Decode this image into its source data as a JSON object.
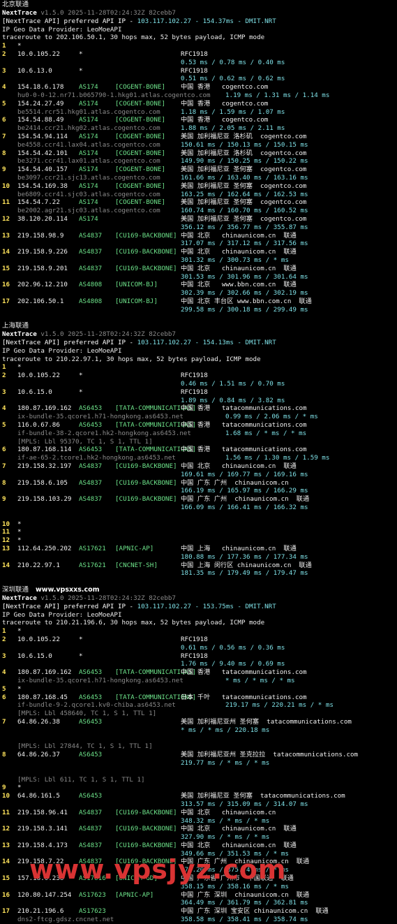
{
  "sections": [
    {
      "title": "北京联通",
      "nt_name": "NextTrace",
      "nt_ver": "v1.5.0 2025-11-28T02:24:32Z 82cebb7",
      "api_line_a": "[NextTrace API] preferred API IP - ",
      "api_ip": "103.117.102.27 - 154.37ms - DMIT.NRT",
      "geo_provider": "IP Geo Data Provider: LeoMoeAPI",
      "trace_line": "traceroute to 202.106.50.1, 30 hops max, 52 bytes payload, ICMP mode",
      "rows": [
        {
          "k": "hop",
          "num": "1",
          "star": "*"
        },
        {
          "k": "hop",
          "num": "2",
          "ip": "10.0.105.22",
          "asn": "*",
          "geo": "RFC1918"
        },
        {
          "k": "lat",
          "lat": "0.53 ms / 0.78 ms / 0.40 ms"
        },
        {
          "k": "hop",
          "num": "3",
          "ip": "10.6.13.0",
          "asn": "*",
          "geo": "RFC1918"
        },
        {
          "k": "lat",
          "lat": "0.51 ms / 0.62 ms / 0.62 ms"
        },
        {
          "k": "hop",
          "num": "4",
          "ip": "154.18.6.178",
          "asn": "AS174",
          "tag": "[COGENT-BONE]",
          "geo": "中国 香港   cogentco.com"
        },
        {
          "k": "hostlat",
          "host": "hu0-0-0-12.nr71.b065790-1.hkg01.atlas.cogentco.com",
          "lat": "1.19 ms / 1.31 ms / 1.14 ms"
        },
        {
          "k": "hop",
          "num": "5",
          "ip": "154.24.27.49",
          "asn": "AS174",
          "tag": "[COGENT-BONE]",
          "geo": "中国 香港   cogentco.com"
        },
        {
          "k": "hostlat2",
          "host": "be5514.rcr51.hkg01.atlas.cogentco.com",
          "lat": "1.18 ms / 1.59 ms / 1.07 ms"
        },
        {
          "k": "hop",
          "num": "6",
          "ip": "154.54.88.49",
          "asn": "AS174",
          "tag": "[COGENT-BONE]",
          "geo": "中国 香港   cogentco.com"
        },
        {
          "k": "hostlat2",
          "host": "be2414.ccr21.hkg02.atlas.cogentco.com",
          "lat": "1.88 ms / 2.05 ms / 2.11 ms"
        },
        {
          "k": "hop",
          "num": "7",
          "ip": "154.54.94.114",
          "asn": "AS174",
          "tag": "[COGENT-BONE]",
          "geo": "美国 加利福尼亚 洛杉矶  cogentco.com"
        },
        {
          "k": "hostlat2",
          "host": "be4558.ccr41.lax04.atlas.cogentco.com",
          "lat": "150.61 ms / 150.13 ms / 150.15 ms"
        },
        {
          "k": "hop",
          "num": "8",
          "ip": "154.54.42.101",
          "asn": "AS174",
          "tag": "[COGENT-BONE]",
          "geo": "美国 加利福尼亚 洛杉矶  cogentco.com"
        },
        {
          "k": "hostlat2",
          "host": "be3271.ccr41.lax01.atlas.cogentco.com",
          "lat": "149.90 ms / 150.25 ms / 150.22 ms"
        },
        {
          "k": "hop",
          "num": "9",
          "ip": "154.54.40.157",
          "asn": "AS174",
          "tag": "[COGENT-BONE]",
          "geo": "美国 加利福尼亚 圣何塞  cogentco.com"
        },
        {
          "k": "hostlat2",
          "host": "be3097.ccr21.sjc13.atlas.cogentco.com",
          "lat": "161.66 ms / 163.40 ms / 163.16 ms"
        },
        {
          "k": "hop",
          "num": "10",
          "ip": "154.54.169.38",
          "asn": "AS174",
          "tag": "[COGENT-BONE]",
          "geo": "美国 加利福尼亚 圣何塞  cogentco.com"
        },
        {
          "k": "hostlat2",
          "host": "be6809.ccr41.sjc03.atlas.cogentco.com",
          "lat": "163.25 ms / 162.64 ms / 162.53 ms"
        },
        {
          "k": "hop",
          "num": "11",
          "ip": "154.54.7.22",
          "asn": "AS174",
          "tag": "[COGENT-BONE]",
          "geo": "美国 加利福尼亚 圣何塞  cogentco.com"
        },
        {
          "k": "hostlat2",
          "host": "be2002.agr21.sjc03.atlas.cogentco.com",
          "lat": "160.74 ms / 160.70 ms / 160.52 ms"
        },
        {
          "k": "hop",
          "num": "12",
          "ip": "38.120.20.114",
          "asn": "AS174",
          "geo": "美国 加利福尼亚 圣何塞  cogentco.com"
        },
        {
          "k": "lat",
          "lat": "356.12 ms / 356.77 ms / 355.87 ms"
        },
        {
          "k": "hop",
          "num": "13",
          "ip": "219.158.98.9",
          "asn": "AS4837",
          "tag": "[CU169-BACKBONE]",
          "geo": "中国 北京   chinaunicom.cn  联通"
        },
        {
          "k": "lat",
          "lat": "317.07 ms / 317.12 ms / 317.56 ms"
        },
        {
          "k": "hop",
          "num": "14",
          "ip": "219.158.9.226",
          "asn": "AS4837",
          "tag": "[CU169-BACKBONE]",
          "geo": "中国 北京   chinaunicom.cn  联通"
        },
        {
          "k": "lat",
          "lat": "301.32 ms / 300.73 ms / * ms"
        },
        {
          "k": "hop",
          "num": "15",
          "ip": "219.158.9.201",
          "asn": "AS4837",
          "tag": "[CU169-BACKBONE]",
          "geo": "中国 北京   chinaunicom.cn  联通"
        },
        {
          "k": "lat",
          "lat": "301.53 ms / 301.96 ms / 301.64 ms"
        },
        {
          "k": "hop",
          "num": "16",
          "ip": "202.96.12.210",
          "asn": "AS4808",
          "tag": "[UNICOM-BJ]",
          "geo": "中国 北京   www.bbn.com.cn  联通"
        },
        {
          "k": "lat",
          "lat": "302.39 ms / 302.66 ms / 302.19 ms"
        },
        {
          "k": "hop",
          "num": "17",
          "ip": "202.106.50.1",
          "asn": "AS4808",
          "tag": "[UNICOM-BJ]",
          "geo": "中国 北京 丰台区 www.bbn.com.cn  联通"
        },
        {
          "k": "lat",
          "lat": "299.58 ms / 300.18 ms / 299.49 ms"
        },
        {
          "k": "gap"
        }
      ]
    },
    {
      "title": "上海联通",
      "nt_name": "NextTrace",
      "nt_ver": "v1.5.0 2025-11-28T02:24:32Z 82cebb7",
      "api_line_a": "[NextTrace API] preferred API IP - ",
      "api_ip": "103.117.102.27 - 154.13ms - DMIT.NRT",
      "geo_provider": "IP Geo Data Provider: LeoMoeAPI",
      "trace_line": "traceroute to 210.22.97.1, 30 hops max, 52 bytes payload, ICMP mode",
      "rows": [
        {
          "k": "hop",
          "num": "1",
          "star": "*"
        },
        {
          "k": "hop",
          "num": "2",
          "ip": "10.0.105.22",
          "asn": "*",
          "geo": "RFC1918"
        },
        {
          "k": "lat",
          "lat": "0.46 ms / 1.51 ms / 0.70 ms"
        },
        {
          "k": "hop",
          "num": "3",
          "ip": "10.6.15.0",
          "asn": "*",
          "geo": "RFC1918"
        },
        {
          "k": "lat",
          "lat": "1.89 ms / 0.84 ms / 3.82 ms"
        },
        {
          "k": "hop",
          "num": "4",
          "ip": "180.87.169.162",
          "asn": "AS6453",
          "tag": "[TATA-COMMUNICATIONS]",
          "geo": "中国 香港   tatacommunications.com"
        },
        {
          "k": "hostlat",
          "host": "ix-bundle-35.qcore1.h71-hongkong.as6453.net",
          "lat": "0.99 ms / 2.06 ms / * ms"
        },
        {
          "k": "hop",
          "num": "5",
          "ip": "116.0.67.86",
          "asn": "AS6453",
          "tag": "[TATA-COMMUNICATIONS]",
          "geo": "中国 香港   tatacommunications.com"
        },
        {
          "k": "hostlat",
          "host": "if-bundle-38-2.qcore1.hk2-hongkong.as6453.net",
          "lat": "1.68 ms / * ms / * ms"
        },
        {
          "k": "mpls",
          "text": "[MPLS: Lbl 95370, TC 1, S 1, TTL 1]"
        },
        {
          "k": "hop",
          "num": "6",
          "ip": "180.87.168.114",
          "asn": "AS6453",
          "tag": "[TATA-COMMUNICATIONS]",
          "geo": "中国 香港   tatacommunications.com"
        },
        {
          "k": "hostlat",
          "host": "if-ae-65-2.tcore1.hk2-hongkong.as6453.net",
          "lat": "1.56 ms / 1.30 ms / 1.59 ms"
        },
        {
          "k": "hop",
          "num": "7",
          "ip": "219.158.32.197",
          "asn": "AS4837",
          "tag": "[CU169-BACKBONE]",
          "geo": "中国 北京   chinaunicom.cn  联通"
        },
        {
          "k": "lat",
          "lat": "169.61 ms / 169.77 ms / 169.16 ms"
        },
        {
          "k": "hop",
          "num": "8",
          "ip": "219.158.6.105",
          "asn": "AS4837",
          "tag": "[CU169-BACKBONE]",
          "geo": "中国 广东 广州  chinaunicom.cn"
        },
        {
          "k": "lat",
          "lat": "166.19 ms / 165.97 ms / 166.29 ms"
        },
        {
          "k": "hop",
          "num": "9",
          "ip": "219.158.103.29",
          "asn": "AS4837",
          "tag": "[CU169-BACKBONE]",
          "geo": "中国 广东 广州  chinaunicom.cn  联通"
        },
        {
          "k": "lat",
          "lat": "166.09 ms / 166.41 ms / 166.32 ms"
        },
        {
          "k": "gap"
        },
        {
          "k": "hop",
          "num": "10",
          "star": "*"
        },
        {
          "k": "hop",
          "num": "11",
          "star": "*"
        },
        {
          "k": "hop",
          "num": "12",
          "star": "*"
        },
        {
          "k": "hop",
          "num": "13",
          "ip": "112.64.250.202",
          "asn": "AS17621",
          "tag": "[APNIC-AP]",
          "geo": "中国 上海   chinaunicom.cn  联通"
        },
        {
          "k": "lat",
          "lat": "180.88 ms / 177.36 ms / 177.34 ms"
        },
        {
          "k": "hop",
          "num": "14",
          "ip": "210.22.97.1",
          "asn": "AS17621",
          "tag": "[CNCNET-SH]",
          "geo": "中国 上海 闵行区 chinaunicom.cn  联通"
        },
        {
          "k": "lat",
          "lat": "181.35 ms / 179.49 ms / 179.47 ms"
        },
        {
          "k": "gap"
        }
      ]
    },
    {
      "title": "深圳联通",
      "url": "www.vpsxxs.com",
      "nt_name": "NextTrace",
      "nt_ver": "v1.5.0 2025-11-28T02:24:32Z 82cebb7",
      "api_line_a": "[NextTrace API] preferred API IP - ",
      "api_ip": "103.117.102.27 - 153.75ms - DMIT.NRT",
      "geo_provider": "IP Geo Data Provider: LeoMoeAPI",
      "trace_line": "traceroute to 210.21.196.6, 30 hops max, 52 bytes payload, ICMP mode",
      "rows": [
        {
          "k": "hop",
          "num": "1",
          "star": "*"
        },
        {
          "k": "hop",
          "num": "2",
          "ip": "10.0.105.22",
          "asn": "*",
          "geo": "RFC1918"
        },
        {
          "k": "lat",
          "lat": "0.61 ms / 0.56 ms / 0.36 ms"
        },
        {
          "k": "hop",
          "num": "3",
          "ip": "10.6.15.0",
          "asn": "*",
          "geo": "RFC1918"
        },
        {
          "k": "lat",
          "lat": "1.76 ms / 9.40 ms / 0.69 ms"
        },
        {
          "k": "hop",
          "num": "4",
          "ip": "180.87.169.162",
          "asn": "AS6453",
          "tag": "[TATA-COMMUNICATIONS]",
          "geo": "中国 香港   tatacommunications.com"
        },
        {
          "k": "hostlat",
          "host": "ix-bundle-35.qcore1.h71-hongkong.as6453.net",
          "lat": "* ms / * ms / * ms"
        },
        {
          "k": "hop",
          "num": "5",
          "star": "*"
        },
        {
          "k": "hop",
          "num": "6",
          "ip": "180.87.168.45",
          "asn": "AS6453",
          "tag": "[TATA-COMMUNICATIONS]",
          "geo": "日本 千叶   tatacommunications.com"
        },
        {
          "k": "hostlat",
          "host": "if-bundle-9-2.qcore1.kv0-chiba.as6453.net",
          "lat": "219.17 ms / 220.21 ms / * ms"
        },
        {
          "k": "mpls",
          "text": "[MPLS: Lbl 458640, TC 1, S 1, TTL 1]"
        },
        {
          "k": "hop",
          "num": "7",
          "ip": "64.86.26.38",
          "asn": "AS6453",
          "geo": "美国 加利福尼亚州 圣何塞  tatacommunications.com"
        },
        {
          "k": "lat",
          "lat": "* ms / * ms / 220.18 ms"
        },
        {
          "k": "gap"
        },
        {
          "k": "mpls",
          "text": "[MPLS: Lbl 27844, TC 1, S 1, TTL 1]"
        },
        {
          "k": "hop",
          "num": "8",
          "ip": "64.86.26.37",
          "asn": "AS6453",
          "geo": "美国 加利福尼亚州 圣克拉拉  tatacommunications.com"
        },
        {
          "k": "lat",
          "lat": "219.77 ms / * ms / * ms"
        },
        {
          "k": "gap"
        },
        {
          "k": "mpls",
          "text": "[MPLS: Lbl 611, TC 1, S 1, TTL 1]"
        },
        {
          "k": "hop",
          "num": "9",
          "star": "*"
        },
        {
          "k": "hop",
          "num": "10",
          "ip": "64.86.161.5",
          "asn": "AS6453",
          "geo": "美国 加利福尼亚 圣何塞  tatacommunications.com"
        },
        {
          "k": "lat",
          "lat": "313.57 ms / 315.09 ms / 314.07 ms"
        },
        {
          "k": "hop",
          "num": "11",
          "ip": "219.158.96.41",
          "asn": "AS4837",
          "tag": "[CU169-BACKBONE]",
          "geo": "中国 北京   chinaunicom.cn"
        },
        {
          "k": "lat",
          "lat": "348.32 ms / * ms / * ms"
        },
        {
          "k": "hop",
          "num": "12",
          "ip": "219.158.3.141",
          "asn": "AS4837",
          "tag": "[CU169-BACKBONE]",
          "geo": "中国 北京   chinaunicom.cn  联通"
        },
        {
          "k": "lat",
          "lat": "327.90 ms / * ms / * ms"
        },
        {
          "k": "hop",
          "num": "13",
          "ip": "219.158.4.173",
          "asn": "AS4837",
          "tag": "[CU169-BACKBONE]",
          "geo": "中国 北京   chinaunicom.cn  联通"
        },
        {
          "k": "lat",
          "lat": "349.66 ms / 351.53 ms / * ms"
        },
        {
          "k": "hop",
          "num": "14",
          "ip": "219.158.7.22",
          "asn": "AS4837",
          "tag": "[CU169-BACKBONE]",
          "geo": "中国 广东 广州  chinaunicom.cn  联通"
        },
        {
          "k": "lat",
          "lat": "375.20 ms / 375.74 ms / * ms"
        },
        {
          "k": "hop",
          "num": "15",
          "ip": "157.18.0.238",
          "asn": "AS17816",
          "tag": "[UNICOM-GD]",
          "geo": "中国 广东省 广州市  中国联通  联通"
        },
        {
          "k": "lat",
          "lat": "358.15 ms / 358.16 ms / * ms"
        },
        {
          "k": "hop",
          "num": "16",
          "ip": "120.80.147.254",
          "asn": "AS17623",
          "tag": "[APNIC-AP]",
          "geo": "中国 广东 深圳  chinaunicom.cn  联通"
        },
        {
          "k": "lat",
          "lat": "364.49 ms / 361.79 ms / 362.81 ms"
        },
        {
          "k": "hop",
          "num": "17",
          "ip": "210.21.196.6",
          "asn": "AS17623",
          "geo": "中国 广东 深圳 宝安区 chinaunicom.cn  联通"
        },
        {
          "k": "hostlat2",
          "host": "dns2-ftcg.gdsz.cncnet.net",
          "lat": "358.58 ms / 358.41 ms / 358.74 ms"
        }
      ]
    }
  ],
  "watermark": "www.vpsjyz.com"
}
